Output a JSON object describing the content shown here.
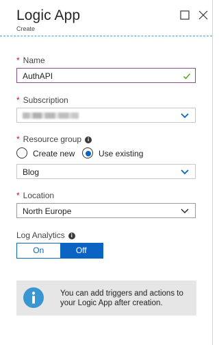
{
  "header": {
    "title": "Logic App",
    "subtitle": "Create"
  },
  "form": {
    "name": {
      "label": "Name",
      "required_mark": "*",
      "value": "AuthAPI"
    },
    "subscription": {
      "label": "Subscription",
      "required_mark": "*"
    },
    "resource_group": {
      "label": "Resource group",
      "required_mark": "*",
      "info": "i",
      "options": [
        "Create new",
        "Use existing"
      ],
      "selected": "Use existing",
      "value": "Blog"
    },
    "location": {
      "label": "Location",
      "required_mark": "*",
      "value": "North Europe"
    },
    "log_analytics": {
      "label": "Log Analytics",
      "info": "i",
      "on_label": "On",
      "off_label": "Off",
      "selected": "Off"
    }
  },
  "notice": {
    "text": "You can add triggers and actions to your Logic App after creation.",
    "icon": "info-icon"
  },
  "colors": {
    "accent": "#0b63c4",
    "required": "#c8102e",
    "focus_border": "#8a4d8c",
    "valid_check": "#5ea72e",
    "notice_bg": "#e6e6e6",
    "notice_icon": "#3a96d0"
  }
}
